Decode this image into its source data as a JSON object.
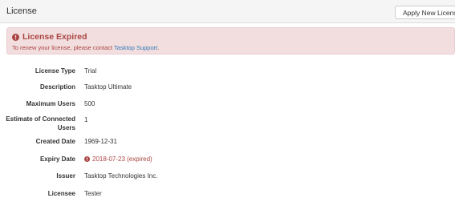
{
  "header": {
    "title": "License",
    "apply_button_label": "Apply New License"
  },
  "alert": {
    "title": "License Expired",
    "message_prefix": "To renew your license, please contact ",
    "support_link": "Tasktop Support",
    "message_suffix": "."
  },
  "details": {
    "license_type_label": "License Type",
    "license_type_value": "Trial",
    "description_label": "Description",
    "description_value": "Tasktop Ultimate",
    "max_users_label": "Maximum Users",
    "max_users_value": "500",
    "connected_users_label": "Estimate of Connected Users",
    "connected_users_value": "1",
    "created_date_label": "Created Date",
    "created_date_value": "1969-12-31",
    "expiry_date_label": "Expiry Date",
    "expiry_date_value": "2018-07-23 (expired)",
    "issuer_label": "Issuer",
    "issuer_value": "Tasktop Technologies Inc.",
    "licensee_label": "Licensee",
    "licensee_value": "Tester"
  },
  "colors": {
    "alert_background": "#f2dede",
    "alert_text": "#a94442",
    "link": "#337ab7",
    "header_background": "#f5f5f5"
  },
  "icons": {
    "apply_button": "edit-icon",
    "alert": "exclamation-circle-icon",
    "expiry": "exclamation-circle-icon"
  }
}
